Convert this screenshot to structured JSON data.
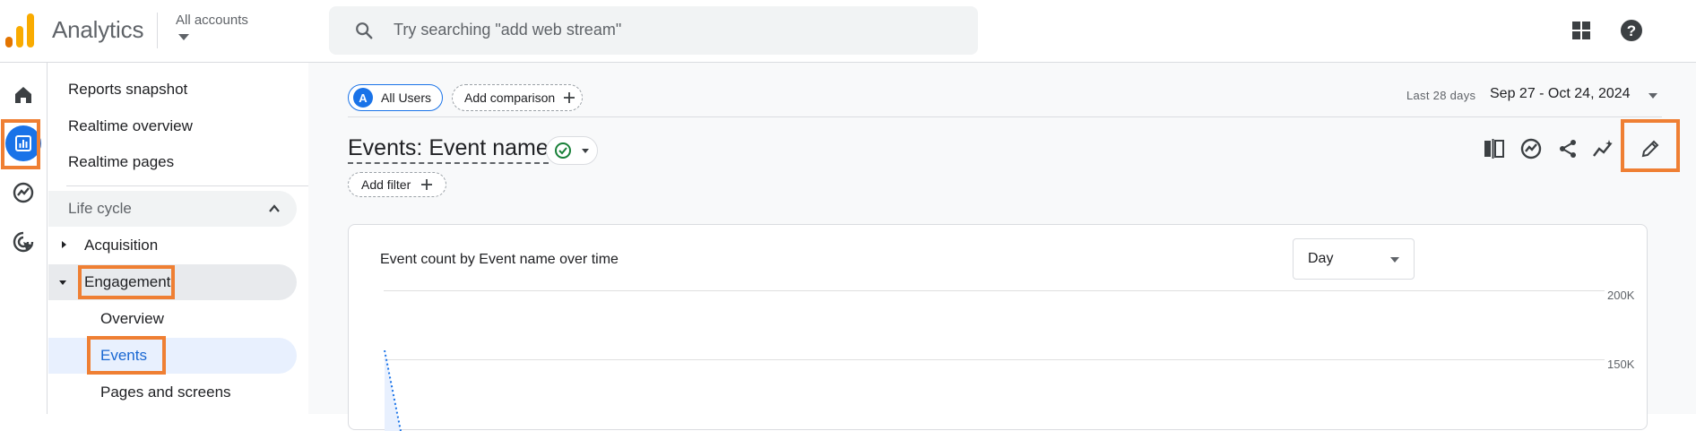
{
  "app": {
    "name": "Analytics",
    "brand_colors": [
      "#f9ab00",
      "#e37400"
    ]
  },
  "header": {
    "account_switcher": "All accounts",
    "search": {
      "placeholder": "Try searching \"add web stream\"",
      "icon": "search-icon"
    },
    "icons": [
      "apps-grid-icon",
      "help-icon"
    ]
  },
  "rail": {
    "items": [
      {
        "icon": "home-icon",
        "active": false
      },
      {
        "icon": "reports-icon",
        "active": true
      },
      {
        "icon": "explore-icon",
        "active": false
      },
      {
        "icon": "advertising-icon",
        "active": false
      }
    ]
  },
  "sidenav": {
    "top_items": [
      "Reports snapshot",
      "Realtime overview",
      "Realtime pages"
    ],
    "section": {
      "label": "Life cycle",
      "expanded": true
    },
    "groups": [
      {
        "label": "Acquisition",
        "expanded": false
      },
      {
        "label": "Engagement",
        "expanded": true
      }
    ],
    "engagement_items": [
      "Overview",
      "Events",
      "Pages and screens"
    ],
    "selected": "Events"
  },
  "main": {
    "comparison_chip": {
      "avatar": "A",
      "label": "All Users"
    },
    "add_comparison": "Add comparison",
    "date": {
      "label": "Last 28 days",
      "range": "Sep 27 - Oct 24, 2024"
    },
    "title": "Events: Event name",
    "add_filter": "Add filter",
    "toolbar_icons": [
      "compare-icon",
      "insights-icon",
      "share-icon",
      "trend-icon",
      "edit-icon"
    ]
  },
  "card": {
    "title": "Event count by Event name over time",
    "granularity": "Day",
    "y_ticks": [
      "200K",
      "150K"
    ]
  },
  "colors": {
    "accent": "#1a73e8",
    "highlight": "#ef7f33",
    "check": "#188038"
  }
}
